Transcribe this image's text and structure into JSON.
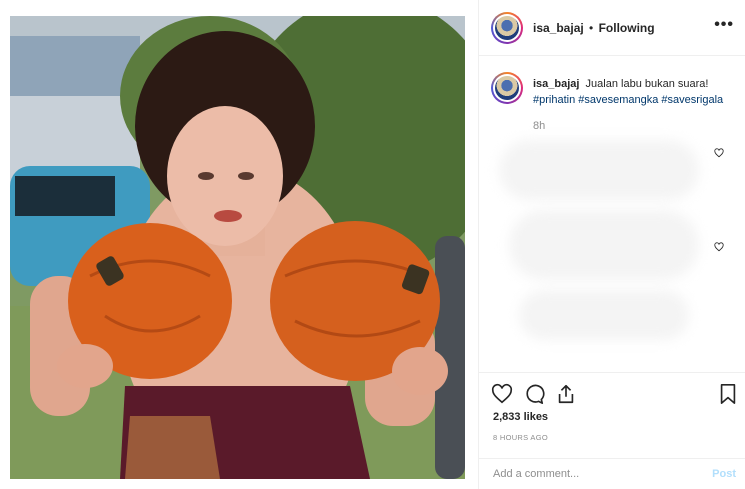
{
  "header": {
    "username": "isa_bajaj",
    "separator": "•",
    "follow_status": "Following",
    "more_label": "•••"
  },
  "caption": {
    "username": "isa_bajaj",
    "text": "Jualan labu bukan suara!",
    "hashtags": "#prihatin #savesemangka #savesrigala",
    "time": "8h"
  },
  "post": {
    "likes": "2,833 likes",
    "posted_ago": "8 HOURS AGO"
  },
  "comment_box": {
    "placeholder": "Add a comment...",
    "post_label": "Post"
  },
  "icons": {
    "like": "heart-icon",
    "comment": "comment-icon",
    "share": "share-icon",
    "save": "bookmark-icon",
    "more": "more-options-icon"
  },
  "colors": {
    "hashtag": "#00376b",
    "muted": "#8e8e8e",
    "post_button": "#b2dffc"
  }
}
